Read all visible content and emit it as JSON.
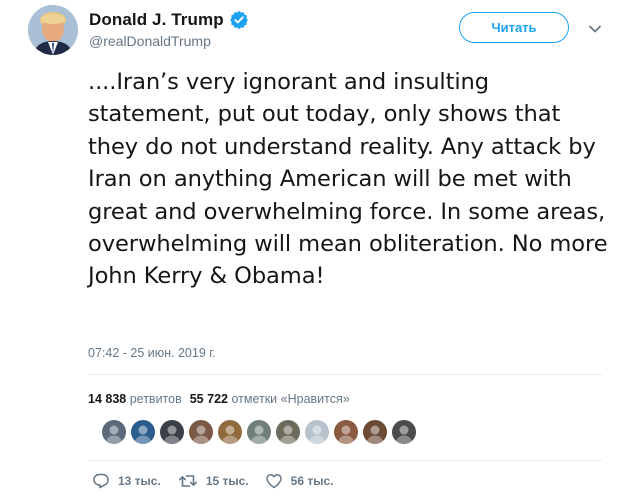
{
  "user": {
    "display_name": "Donald J. Trump",
    "handle": "@realDonaldTrump",
    "verified": true
  },
  "follow_button": {
    "label": "Читать"
  },
  "tweet": {
    "text": "....Iran’s very ignorant and insulting statement, put out today, only shows that they do not understand reality. Any attack by Iran on anything American will be met with great and overwhelming force. In some areas, overwhelming will mean obliteration. No more John Kerry & Obama!",
    "timestamp": "07:42 - 25 июн. 2019 г."
  },
  "stats": {
    "retweets_count": "14 838",
    "retweets_label": "ретвитов",
    "likes_count": "55 722",
    "likes_label": "отметки «Нравится»"
  },
  "likers": [
    {
      "color": "#5a6a7a"
    },
    {
      "color": "#2c5d8f"
    },
    {
      "color": "#3a4048"
    },
    {
      "color": "#7a5a46"
    },
    {
      "color": "#8e6a3c"
    },
    {
      "color": "#6f7f7a"
    },
    {
      "color": "#6d6b58"
    },
    {
      "color": "#b8c2cc"
    },
    {
      "color": "#8a5a40"
    },
    {
      "color": "#6b4a36"
    },
    {
      "color": "#4b4b4b"
    }
  ],
  "actions": {
    "replies": "13 тыс.",
    "retweets": "15 тыс.",
    "likes": "56 тыс."
  },
  "icons": {
    "verified": "verified-badge-icon",
    "caret": "chevron-down-icon",
    "reply": "reply-icon",
    "retweet": "retweet-icon",
    "like": "heart-icon"
  },
  "colors": {
    "accent": "#1da1f2",
    "text": "#14171a",
    "muted": "#657786",
    "divider": "#e6ecf0"
  }
}
